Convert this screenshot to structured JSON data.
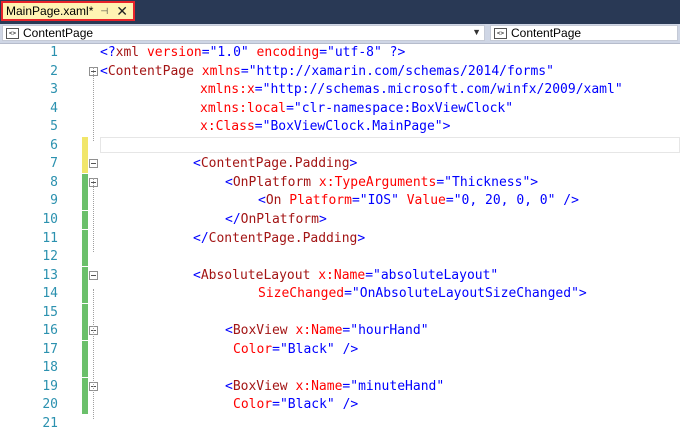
{
  "tab": {
    "title": "MainPage.xaml*",
    "pin_icon": "pin-icon",
    "close_icon": "close-icon"
  },
  "navigation": {
    "left_label": "ContentPage",
    "right_label": "ContentPage"
  },
  "colors": {
    "line_number": "#2b91af",
    "tag": "#a31515",
    "attribute": "#ff0000",
    "value": "#0000ff",
    "saved_change": "#6bc06b",
    "unsaved_change": "#f1e66a"
  },
  "code": {
    "lines": [
      {
        "number": "1",
        "segments": [
          {
            "kind": "p",
            "text": "<?"
          },
          {
            "kind": "t",
            "text": "xml"
          },
          {
            "kind": "a",
            "text": " version"
          },
          {
            "kind": "p",
            "text": "="
          },
          {
            "kind": "v",
            "text": "\"1.0\""
          },
          {
            "kind": "a",
            "text": " encoding"
          },
          {
            "kind": "p",
            "text": "="
          },
          {
            "kind": "v",
            "text": "\"utf-8\""
          },
          {
            "kind": "p",
            "text": " ?>"
          }
        ]
      },
      {
        "number": "2",
        "segments": [
          {
            "kind": "p",
            "text": "<"
          },
          {
            "kind": "t",
            "text": "ContentPage"
          },
          {
            "kind": "a",
            "text": " xmlns"
          },
          {
            "kind": "p",
            "text": "="
          },
          {
            "kind": "v",
            "text": "\"http://xamarin.com/schemas/2014/forms\""
          }
        ]
      },
      {
        "number": "3",
        "segments": [
          {
            "kind": "a",
            "text": "xmlns:x"
          },
          {
            "kind": "p",
            "text": "="
          },
          {
            "kind": "v",
            "text": "\"http://schemas.microsoft.com/winfx/2009/xaml\""
          }
        ]
      },
      {
        "number": "4",
        "segments": [
          {
            "kind": "a",
            "text": "xmlns:local"
          },
          {
            "kind": "p",
            "text": "="
          },
          {
            "kind": "v",
            "text": "\"clr-namespace:BoxViewClock\""
          }
        ]
      },
      {
        "number": "5",
        "segments": [
          {
            "kind": "a",
            "text": "x:Class"
          },
          {
            "kind": "p",
            "text": "="
          },
          {
            "kind": "v",
            "text": "\"BoxViewClock.MainPage\""
          },
          {
            "kind": "p",
            "text": ">"
          }
        ]
      },
      {
        "number": "6",
        "segments": []
      },
      {
        "number": "7",
        "segments": [
          {
            "kind": "p",
            "text": "<"
          },
          {
            "kind": "t",
            "text": "ContentPage.Padding"
          },
          {
            "kind": "p",
            "text": ">"
          }
        ]
      },
      {
        "number": "8",
        "segments": [
          {
            "kind": "p",
            "text": "<"
          },
          {
            "kind": "t",
            "text": "OnPlatform"
          },
          {
            "kind": "a",
            "text": " x:TypeArguments"
          },
          {
            "kind": "p",
            "text": "="
          },
          {
            "kind": "v",
            "text": "\"Thickness\""
          },
          {
            "kind": "p",
            "text": ">"
          }
        ]
      },
      {
        "number": "9",
        "segments": [
          {
            "kind": "p",
            "text": "<"
          },
          {
            "kind": "t",
            "text": "On"
          },
          {
            "kind": "a",
            "text": " Platform"
          },
          {
            "kind": "p",
            "text": "="
          },
          {
            "kind": "v",
            "text": "\"IOS\""
          },
          {
            "kind": "a",
            "text": " Value"
          },
          {
            "kind": "p",
            "text": "="
          },
          {
            "kind": "v",
            "text": "\"0, 20, 0, 0\""
          },
          {
            "kind": "p",
            "text": " />"
          }
        ]
      },
      {
        "number": "10",
        "segments": [
          {
            "kind": "p",
            "text": "</"
          },
          {
            "kind": "t",
            "text": "OnPlatform"
          },
          {
            "kind": "p",
            "text": ">"
          }
        ]
      },
      {
        "number": "11",
        "segments": [
          {
            "kind": "p",
            "text": "</"
          },
          {
            "kind": "t",
            "text": "ContentPage.Padding"
          },
          {
            "kind": "p",
            "text": ">"
          }
        ]
      },
      {
        "number": "12",
        "segments": []
      },
      {
        "number": "13",
        "segments": [
          {
            "kind": "p",
            "text": "<"
          },
          {
            "kind": "t",
            "text": "AbsoluteLayout"
          },
          {
            "kind": "a",
            "text": " x:Name"
          },
          {
            "kind": "p",
            "text": "="
          },
          {
            "kind": "v",
            "text": "\"absoluteLayout\""
          }
        ]
      },
      {
        "number": "14",
        "segments": [
          {
            "kind": "a",
            "text": "SizeChanged"
          },
          {
            "kind": "p",
            "text": "="
          },
          {
            "kind": "v",
            "text": "\"OnAbsoluteLayoutSizeChanged\""
          },
          {
            "kind": "p",
            "text": ">"
          }
        ]
      },
      {
        "number": "15",
        "segments": []
      },
      {
        "number": "16",
        "segments": [
          {
            "kind": "p",
            "text": "<"
          },
          {
            "kind": "t",
            "text": "BoxView"
          },
          {
            "kind": "a",
            "text": " x:Name"
          },
          {
            "kind": "p",
            "text": "="
          },
          {
            "kind": "v",
            "text": "\"hourHand\""
          }
        ]
      },
      {
        "number": "17",
        "segments": [
          {
            "kind": "a",
            "text": "Color"
          },
          {
            "kind": "p",
            "text": "="
          },
          {
            "kind": "v",
            "text": "\"Black\""
          },
          {
            "kind": "p",
            "text": " />"
          }
        ]
      },
      {
        "number": "18",
        "segments": []
      },
      {
        "number": "19",
        "segments": [
          {
            "kind": "p",
            "text": "<"
          },
          {
            "kind": "t",
            "text": "BoxView"
          },
          {
            "kind": "a",
            "text": " x:Name"
          },
          {
            "kind": "p",
            "text": "="
          },
          {
            "kind": "v",
            "text": "\"minuteHand\""
          }
        ]
      },
      {
        "number": "20",
        "segments": [
          {
            "kind": "a",
            "text": "Color"
          },
          {
            "kind": "p",
            "text": "="
          },
          {
            "kind": "v",
            "text": "\"Black\""
          },
          {
            "kind": "p",
            "text": " />"
          }
        ]
      },
      {
        "number": "21",
        "segments": []
      }
    ]
  }
}
